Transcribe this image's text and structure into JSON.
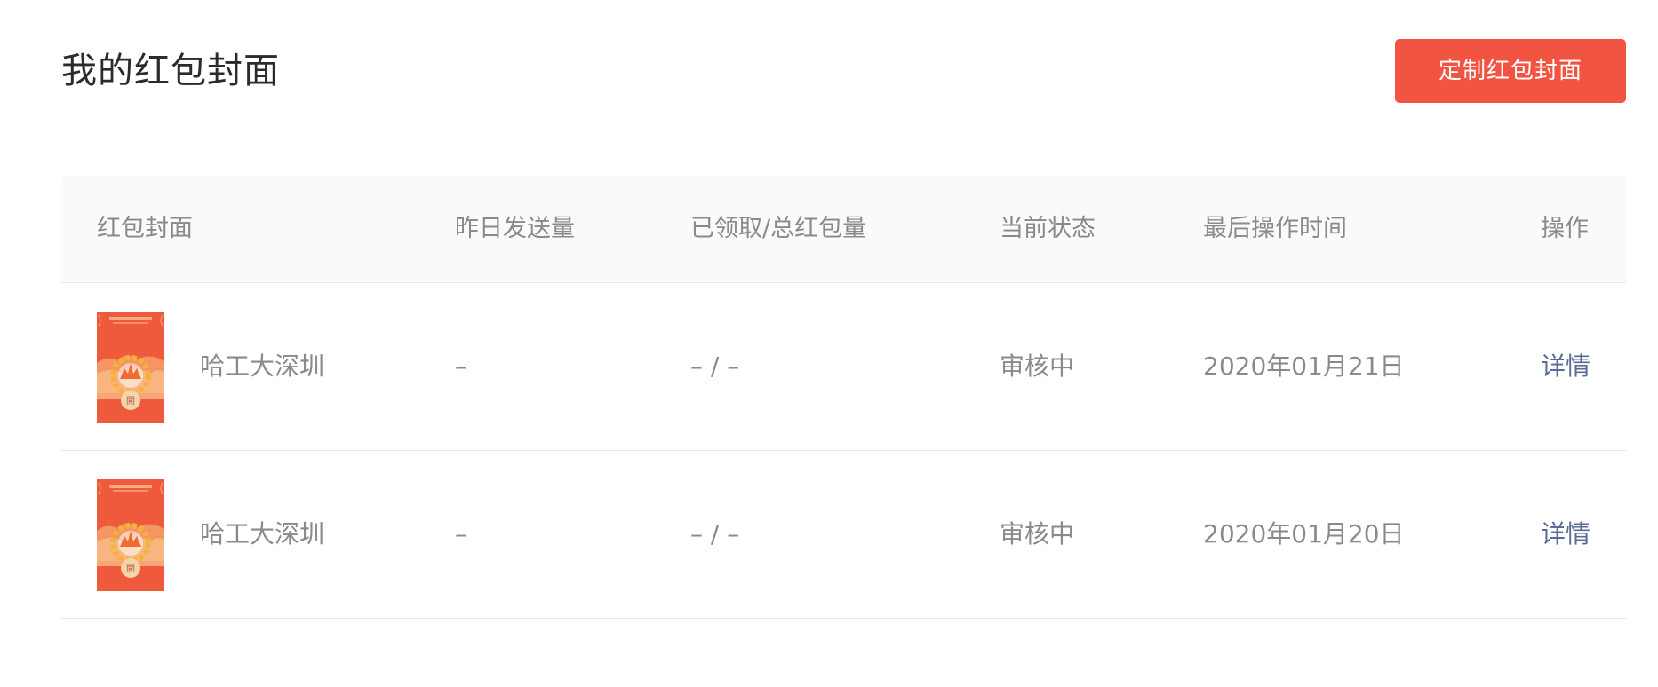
{
  "page": {
    "title": "我的红包封面",
    "primary_button_label": "定制红包封面"
  },
  "colors": {
    "brand_red": "#f25442",
    "link_blue": "#576b95",
    "muted_text": "#8a8a8a"
  },
  "table": {
    "headers": {
      "cover": "红包封面",
      "yesterday_sent": "昨日发送量",
      "received_total": "已领取/总红包量",
      "status": "当前状态",
      "last_operated": "最后操作时间",
      "action": "操作"
    },
    "rows": [
      {
        "cover_name": "哈工大深圳",
        "cover_badge": "開",
        "yesterday_sent": "–",
        "received_total": "– / –",
        "status": "审核中",
        "last_operated": "2020年01月21日",
        "action_label": "详情"
      },
      {
        "cover_name": "哈工大深圳",
        "cover_badge": "開",
        "yesterday_sent": "–",
        "received_total": "– / –",
        "status": "审核中",
        "last_operated": "2020年01月20日",
        "action_label": "详情"
      }
    ]
  }
}
